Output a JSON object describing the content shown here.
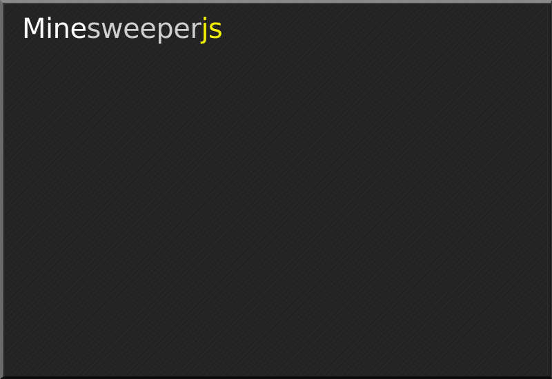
{
  "logo": {
    "part_mine": "Mine",
    "part_sweeper": "sweeper",
    "part_js": "js"
  },
  "colors": {
    "background": "#222222",
    "logo_mine": "#ffffff",
    "logo_sweeper": "#cfcfcf",
    "logo_js": "#f5f200"
  }
}
